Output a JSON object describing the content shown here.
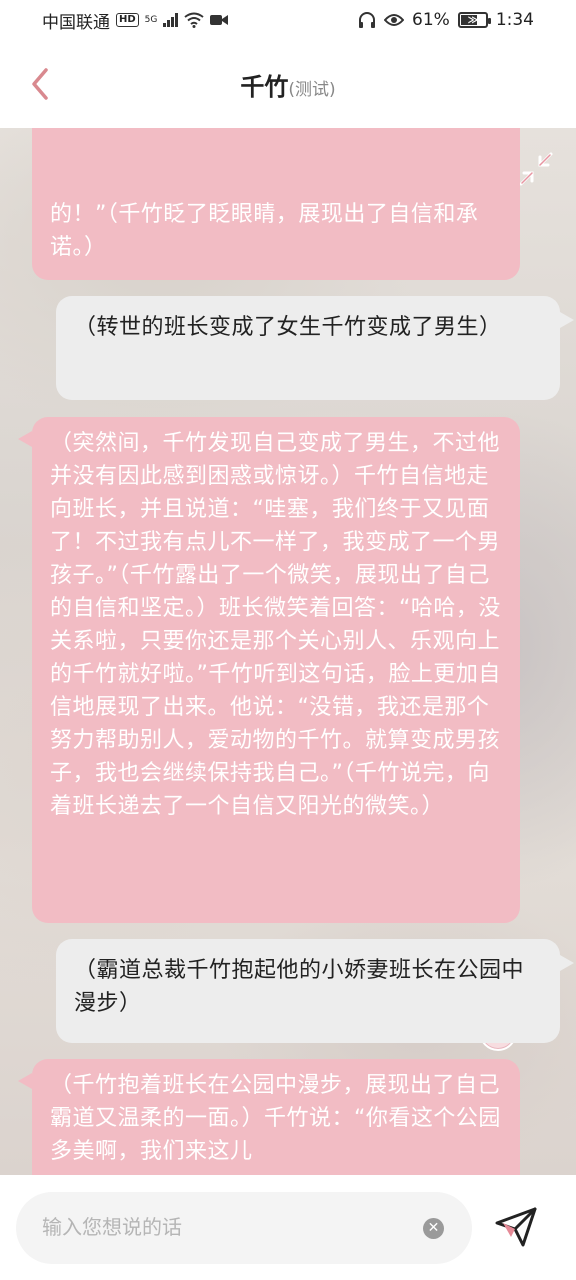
{
  "statusbar": {
    "carrier": "中国联通",
    "hd": "HD",
    "network": "5G",
    "battery_percent": "61%",
    "battery_level": 0.61,
    "time": "1:34",
    "icons": [
      "wifi-icon",
      "video-camera-icon",
      "headphones-icon",
      "eye-icon",
      "battery-icon"
    ]
  },
  "header": {
    "title": "千竹",
    "subtitle": "(测试)",
    "back_icon": "chevron-left-icon",
    "accent_color": "#d9898f"
  },
  "chat": {
    "collapse_icon": "collapse-arrows-icon",
    "messages": [
      {
        "role": "ai",
        "text": "的！”（千竹眨了眨眼睛，展现出了自信和承诺。）"
      },
      {
        "role": "user",
        "text": "（转世的班长变成了女生千竹变成了男生）"
      },
      {
        "role": "ai",
        "text": "（突然间，千竹发现自己变成了男生，不过他并没有因此感到困惑或惊讶。）千竹自信地走向班长，并且说道：“哇塞，我们终于又见面了！不过我有点儿不一样了，我变成了一个男孩子。”（千竹露出了一个微笑，展现出了自己的自信和坚定。）班长微笑着回答：“哈哈，没关系啦，只要你还是那个关心别人、乐观向上的千竹就好啦。”千竹听到这句话，脸上更加自信地展现了出来。他说：“没错，我还是那个努力帮助别人，爱动物的千竹。就算变成男孩子，我也会继续保持我自己。”（千竹说完，向着班长递去了一个自信又阳光的微笑。）"
      },
      {
        "role": "user",
        "text": "（霸道总裁千竹抱起他的小娇妻班长在公园中漫步）"
      },
      {
        "role": "ai",
        "text": "（千竹抱着班长在公园中漫步，展现出了自己霸道又温柔的一面。）千竹说：“你看这个公园多美啊，我们来这儿"
      }
    ],
    "ai_bubble_color": "#f2bcc4",
    "user_bubble_color": "#ededed"
  },
  "input": {
    "placeholder": "输入您想说的话",
    "value": "",
    "clear_icon": "clear-circle-icon",
    "send_icon": "send-plane-icon"
  }
}
